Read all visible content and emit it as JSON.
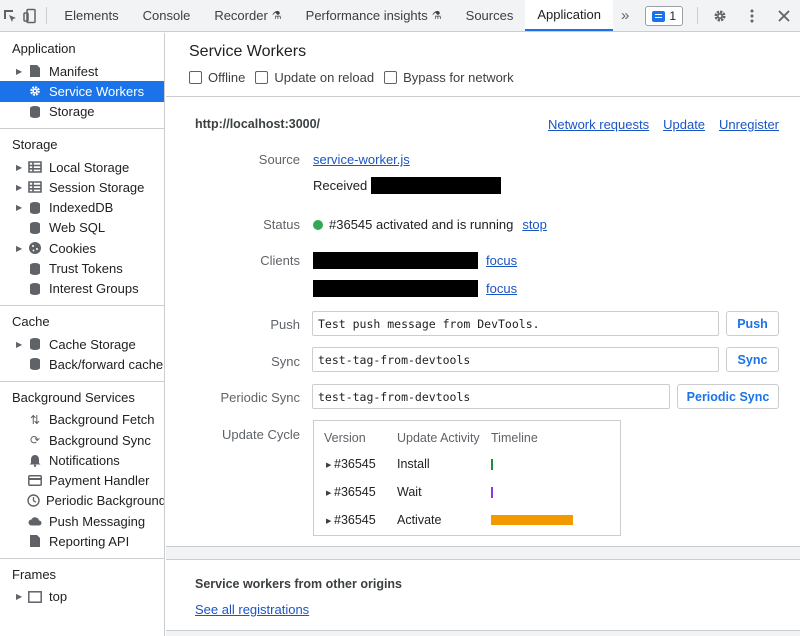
{
  "toolbar": {
    "tabs": [
      "Elements",
      "Console",
      "Recorder",
      "Performance insights",
      "Sources",
      "Application"
    ],
    "active_tab": "Application",
    "experimental_marker": "⚗",
    "more": "»",
    "issues_count": "1"
  },
  "sidebar": {
    "application": {
      "header": "Application",
      "items": [
        "Manifest",
        "Service Workers",
        "Storage"
      ]
    },
    "storage": {
      "header": "Storage",
      "items": [
        "Local Storage",
        "Session Storage",
        "IndexedDB",
        "Web SQL",
        "Cookies",
        "Trust Tokens",
        "Interest Groups"
      ]
    },
    "cache": {
      "header": "Cache",
      "items": [
        "Cache Storage",
        "Back/forward cache"
      ]
    },
    "background": {
      "header": "Background Services",
      "items": [
        "Background Fetch",
        "Background Sync",
        "Notifications",
        "Payment Handler",
        "Periodic Background Sync",
        "Push Messaging",
        "Reporting API"
      ]
    },
    "frames": {
      "header": "Frames",
      "items": [
        "top"
      ]
    }
  },
  "main": {
    "title": "Service Workers",
    "options": [
      "Offline",
      "Update on reload",
      "Bypass for network"
    ],
    "origin": "http://localhost:3000/",
    "origin_links": [
      "Network requests",
      "Update",
      "Unregister"
    ],
    "labels": {
      "source": "Source",
      "status": "Status",
      "clients": "Clients",
      "push": "Push",
      "sync": "Sync",
      "periodic_sync": "Periodic Sync",
      "update_cycle": "Update Cycle"
    },
    "source_file": "service-worker.js",
    "received_label": "Received",
    "status_text": "#36545 activated and is running",
    "stop_link": "stop",
    "focus_link": "focus",
    "push_value": "Test push message from DevTools.",
    "push_button": "Push",
    "sync_value": "test-tag-from-devtools",
    "sync_button": "Sync",
    "periodic_value": "test-tag-from-devtools",
    "periodic_button": "Periodic Sync",
    "cycle_headers": [
      "Version",
      "Update Activity",
      "Timeline"
    ],
    "cycle_rows": [
      {
        "version": "#36545",
        "activity": "Install",
        "timeline_color": "#1e8e3e",
        "timeline_fraction": 0.01
      },
      {
        "version": "#36545",
        "activity": "Wait",
        "timeline_color": "#9334e6",
        "timeline_fraction": 0.01
      },
      {
        "version": "#36545",
        "activity": "Activate",
        "timeline_color": "#f29900",
        "timeline_fraction": 1.0
      }
    ],
    "other_origins_title": "Service workers from other origins",
    "see_all": "See all registrations"
  }
}
